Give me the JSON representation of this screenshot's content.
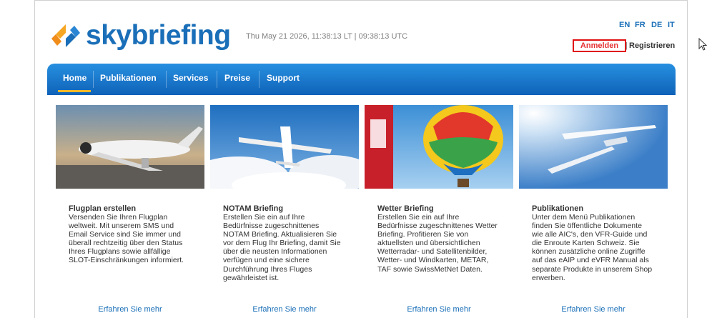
{
  "header": {
    "brand": "skybriefing",
    "datetime": "Thu May 21 2026, 11:38:13 LT | 09:38:13 UTC",
    "languages": [
      "EN",
      "FR",
      "DE",
      "IT"
    ],
    "login_label": "Anmelden",
    "register_label": "Registrieren",
    "brand_color": "#1a6fb8",
    "login_color": "#e53030"
  },
  "nav": {
    "items": [
      {
        "label": "Home",
        "active": true
      },
      {
        "label": "Publikationen"
      },
      {
        "label": "Services"
      },
      {
        "label": "Preise"
      },
      {
        "label": "Support"
      }
    ],
    "active_indicator_color": "#f2b82a"
  },
  "cards": [
    {
      "title": "Flugplan erstellen",
      "text": "Versenden Sie Ihren Flugplan weltweit. Mit unserem SMS und Email Service sind Sie immer und überall rechtzeitig über den Status Ihres Flugplans sowie allfällige SLOT-Einschränkungen informiert.",
      "link": "Erfahren Sie mehr",
      "image": "business-jet"
    },
    {
      "title": "NOTAM Briefing",
      "text": "Erstellen Sie ein auf Ihre Bedürfnisse zugeschnittenes NOTAM Briefing. Aktualisieren Sie vor dem Flug Ihr Briefing, damit Sie über die neusten Informationen verfügen und eine sichere Durchführung Ihres Fluges gewährleistet ist.",
      "link": "Erfahren Sie mehr",
      "image": "small-plane-sky"
    },
    {
      "title": "Wetter Briefing",
      "text": "Erstellen Sie ein auf Ihre Bedürfnisse zugeschnittenes Wetter Briefing. Profitieren Sie von aktuellsten und übersichtlichen Wetterradar- und Satellitenbilder, Wetter- und Windkarten, METAR, TAF sowie SwissMetNet Daten.",
      "link": "Erfahren Sie mehr",
      "image": "hot-air-balloon"
    },
    {
      "title": "Publikationen",
      "text": "Unter dem Menü Publikationen finden Sie öffentliche Dokumente wie alle AIC's, den VFR-Guide und die Enroute Karten Schweiz. Sie können zusätzliche online Zugriffe auf das eAIP und eVFR Manual als separate Produkte in unserem Shop erwerben.",
      "link": "Erfahren Sie mehr",
      "image": "glider-sky"
    }
  ]
}
